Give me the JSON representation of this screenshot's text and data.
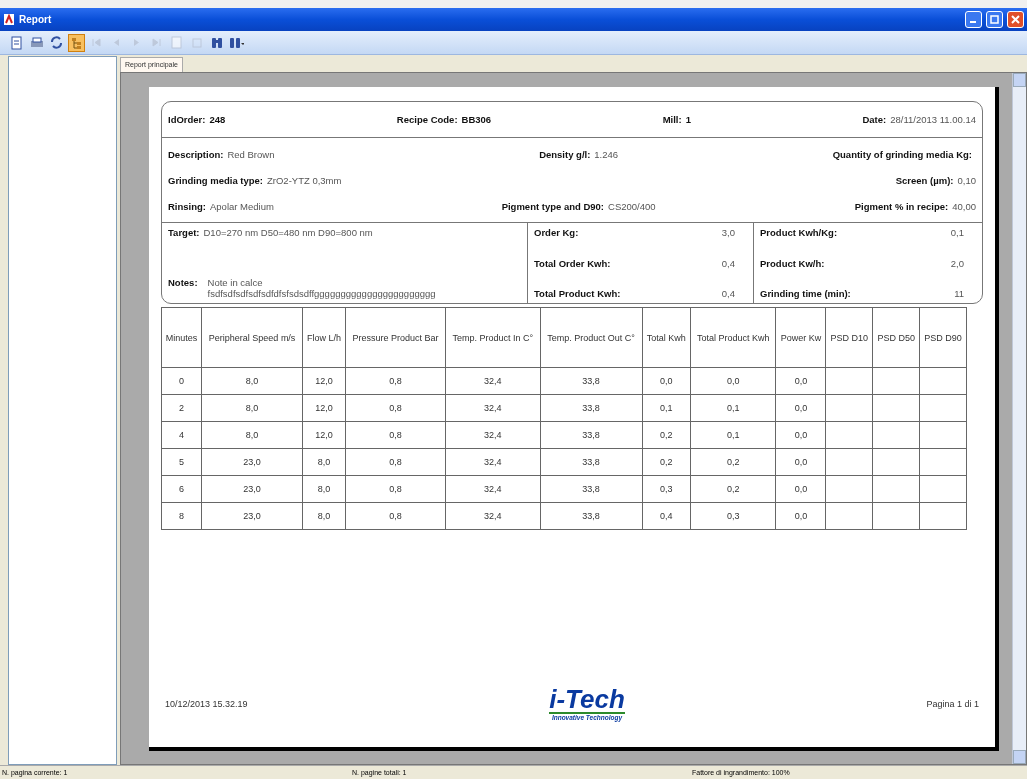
{
  "window": {
    "title": "Report"
  },
  "toolbar": [
    {
      "kind": "export",
      "disabled": false,
      "selected": false
    },
    {
      "kind": "print",
      "disabled": false,
      "selected": false
    },
    {
      "kind": "refresh",
      "disabled": false,
      "selected": false
    },
    {
      "kind": "tree",
      "disabled": false,
      "selected": true
    },
    {
      "kind": "first",
      "disabled": true,
      "selected": false
    },
    {
      "kind": "prev",
      "disabled": true,
      "selected": false
    },
    {
      "kind": "next",
      "disabled": true,
      "selected": false
    },
    {
      "kind": "last",
      "disabled": true,
      "selected": false
    },
    {
      "kind": "page",
      "disabled": true,
      "selected": false
    },
    {
      "kind": "stop",
      "disabled": true,
      "selected": false
    },
    {
      "kind": "binoculars",
      "disabled": false,
      "selected": false
    },
    {
      "kind": "zoom",
      "disabled": false,
      "selected": false
    }
  ],
  "tabs": [
    {
      "label": "Report principale",
      "selected": true
    }
  ],
  "report": {
    "top": [
      {
        "label": "IdOrder:",
        "value": "248",
        "value_bold": true
      },
      {
        "label": "Recipe Code:",
        "value": "BB306",
        "value_bold": true
      },
      {
        "label": "Mill:",
        "value": "1",
        "value_bold": true
      },
      {
        "label": "Date:",
        "value": "28/11/2013 11.00.14",
        "value_bold": false
      }
    ],
    "info_rows": [
      {
        "left": {
          "label": "Description:",
          "value": "Red Brown"
        },
        "middle": {
          "label": "Density g/l:",
          "value": "1.246"
        },
        "right": {
          "label": "Quantity of grinding media Kg:"
        }
      },
      {
        "left": {
          "label": "Grinding media type:",
          "value": "ZrO2-YTZ 0,3mm"
        },
        "right": {
          "label": "Screen (µm):",
          "value": "0,10"
        }
      },
      {
        "left": {
          "label": "Rinsing:",
          "value": "Apolar Medium"
        },
        "middle": {
          "label": "Pigment type and D90:",
          "value": "CS200/400"
        },
        "right": {
          "label": "Pigment % in recipe:",
          "value": "40,00"
        }
      }
    ],
    "target": {
      "label": "Target:",
      "value": "D10=270 nm D50=480 nm  D90=800 nm"
    },
    "notes": {
      "label": "Notes:",
      "lines": [
        "Note in calce",
        "fsdfsdfsdfsdfsdfdfsfsdsdffggggggggggggggggggggggg"
      ]
    },
    "order_stats": [
      {
        "label": "Order Kg:",
        "value": "3,0"
      },
      {
        "label": "Total Order Kwh:",
        "value": "0,4"
      },
      {
        "label": "Total Product Kwh:",
        "value": "0,4"
      }
    ],
    "product_stats": [
      {
        "label": "Product Kwh/Kg:",
        "value": "0,1"
      },
      {
        "label": "Product Kw/h:",
        "value": "2,0"
      },
      {
        "label": "Grinding time (min):",
        "value": "11"
      }
    ],
    "table": {
      "columns": [
        "Minutes",
        "Peripheral Speed m/s",
        "Flow L/h",
        "Pressure Product Bar",
        "Temp. Product In C°",
        "Temp. Product Out C°",
        "Total Kwh",
        "Total Product Kwh",
        "Power Kw",
        "PSD D10",
        "PSD D50",
        "PSD D90"
      ],
      "rows": [
        [
          "0",
          "8,0",
          "12,0",
          "0,8",
          "32,4",
          "33,8",
          "0,0",
          "0,0",
          "0,0"
        ],
        [
          "2",
          "8,0",
          "12,0",
          "0,8",
          "32,4",
          "33,8",
          "0,1",
          "0,1",
          "0,0"
        ],
        [
          "4",
          "8,0",
          "12,0",
          "0,8",
          "32,4",
          "33,8",
          "0,2",
          "0,1",
          "0,0"
        ],
        [
          "5",
          "23,0",
          "8,0",
          "0,8",
          "32,4",
          "33,8",
          "0,2",
          "0,2",
          "0,0"
        ],
        [
          "6",
          "23,0",
          "8,0",
          "0,8",
          "32,4",
          "33,8",
          "0,3",
          "0,2",
          "0,0"
        ],
        [
          "8",
          "23,0",
          "8,0",
          "0,8",
          "32,4",
          "33,8",
          "0,4",
          "0,3",
          "0,0"
        ]
      ]
    },
    "footer": {
      "printed": "10/12/2013  15.32.19",
      "logo": "i-Tech",
      "tagline": "Innovative Technology",
      "page": "Pagina 1 di 1"
    }
  },
  "status_bar": [
    "N. pagina corrente: 1",
    "N. pagine totali: 1",
    "Fattore di ingrandimento: 100%"
  ]
}
